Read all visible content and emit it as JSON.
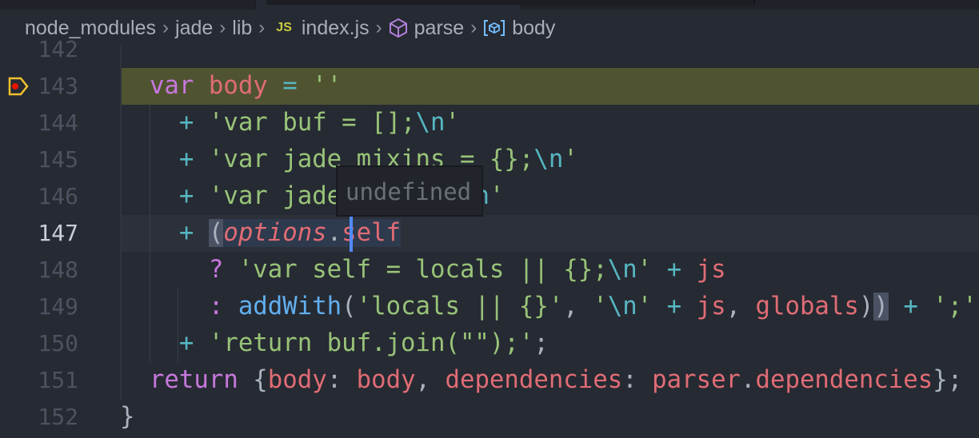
{
  "breadcrumb": [
    {
      "label": "node_modules"
    },
    {
      "label": "jade"
    },
    {
      "label": "lib"
    },
    {
      "label": "index.js",
      "icon": "js-file-icon",
      "icon_text": "JS"
    },
    {
      "label": "parse",
      "icon": "method-cube-icon"
    },
    {
      "label": "body",
      "icon": "variable-icon"
    }
  ],
  "hover_tooltip": "undefined",
  "colors": {
    "keyword": "#c678dd",
    "variable": "#e06c75",
    "string": "#98c379",
    "operator": "#56b6c2",
    "function": "#61afef",
    "debug_line": "#505330"
  },
  "editor": {
    "current_line": 147,
    "paused_line": 143,
    "lines": [
      {
        "n": "142",
        "tokens": []
      },
      {
        "n": "143",
        "tokens": [
          [
            "  ",
            ""
          ],
          [
            "var",
            "kw"
          ],
          [
            " ",
            ""
          ],
          [
            "body",
            "var"
          ],
          [
            " ",
            ""
          ],
          [
            "=",
            "op"
          ],
          [
            " ",
            ""
          ],
          [
            "''",
            "str"
          ]
        ]
      },
      {
        "n": "144",
        "tokens": [
          [
            "    ",
            ""
          ],
          [
            "+",
            "op"
          ],
          [
            " ",
            ""
          ],
          [
            "'var buf = [];",
            "str"
          ],
          [
            "\\n",
            "op"
          ],
          [
            "'",
            "str"
          ]
        ]
      },
      {
        "n": "145",
        "tokens": [
          [
            "    ",
            ""
          ],
          [
            "+",
            "op"
          ],
          [
            " ",
            ""
          ],
          [
            "'var jade_mixins = {};",
            "str"
          ],
          [
            "\\n",
            "op"
          ],
          [
            "'",
            "str"
          ]
        ]
      },
      {
        "n": "146",
        "tokens": [
          [
            "    ",
            ""
          ],
          [
            "+",
            "op"
          ],
          [
            " ",
            ""
          ],
          [
            "'var jade_interp;",
            "str"
          ],
          [
            "\\n",
            "op"
          ],
          [
            "'",
            "str"
          ]
        ]
      },
      {
        "n": "147",
        "tokens": [
          [
            "    ",
            ""
          ],
          [
            "+",
            "op"
          ],
          [
            " ",
            ""
          ],
          [
            "(",
            "brk"
          ],
          [
            "options",
            "it sel"
          ],
          [
            ".",
            "pn sel"
          ],
          [
            "self",
            "var sel"
          ]
        ]
      },
      {
        "n": "148",
        "tokens": [
          [
            "      ",
            ""
          ],
          [
            "?",
            "kw"
          ],
          [
            " ",
            ""
          ],
          [
            "'var self = locals || {};",
            "str"
          ],
          [
            "\\n",
            "op"
          ],
          [
            "'",
            "str"
          ],
          [
            " ",
            ""
          ],
          [
            "+",
            "op"
          ],
          [
            " ",
            ""
          ],
          [
            "js",
            "var"
          ]
        ]
      },
      {
        "n": "149",
        "tokens": [
          [
            "      ",
            ""
          ],
          [
            ":",
            "kw"
          ],
          [
            " ",
            ""
          ],
          [
            "addWith",
            "fn"
          ],
          [
            "(",
            "pn"
          ],
          [
            "'locals || {}'",
            "str"
          ],
          [
            ", ",
            "pn"
          ],
          [
            "'",
            "str"
          ],
          [
            "\\n",
            "op"
          ],
          [
            "'",
            "str"
          ],
          [
            " ",
            ""
          ],
          [
            "+",
            "op"
          ],
          [
            " ",
            ""
          ],
          [
            "js",
            "var"
          ],
          [
            ", ",
            "pn"
          ],
          [
            "globals",
            "var"
          ],
          [
            ")",
            "pn"
          ],
          [
            ")",
            "brk"
          ],
          [
            " ",
            ""
          ],
          [
            "+",
            "op"
          ],
          [
            " ",
            ""
          ],
          [
            "';'",
            "str"
          ]
        ]
      },
      {
        "n": "150",
        "tokens": [
          [
            "    ",
            ""
          ],
          [
            "+",
            "op"
          ],
          [
            " ",
            ""
          ],
          [
            "'return buf.join(\"\");'",
            "str"
          ],
          [
            ";",
            "pn"
          ]
        ]
      },
      {
        "n": "151",
        "tokens": [
          [
            "  ",
            ""
          ],
          [
            "return",
            "kw"
          ],
          [
            " ",
            ""
          ],
          [
            "{",
            "pn"
          ],
          [
            "body",
            "var"
          ],
          [
            ": ",
            "pn"
          ],
          [
            "body",
            "var"
          ],
          [
            ", ",
            "pn"
          ],
          [
            "dependencies",
            "var"
          ],
          [
            ": ",
            "pn"
          ],
          [
            "parser",
            "var"
          ],
          [
            ".",
            "pn"
          ],
          [
            "dependencies",
            "var"
          ],
          [
            "};",
            "pn"
          ]
        ]
      },
      {
        "n": "152",
        "tokens": [
          [
            "}",
            "pn"
          ]
        ]
      }
    ]
  }
}
